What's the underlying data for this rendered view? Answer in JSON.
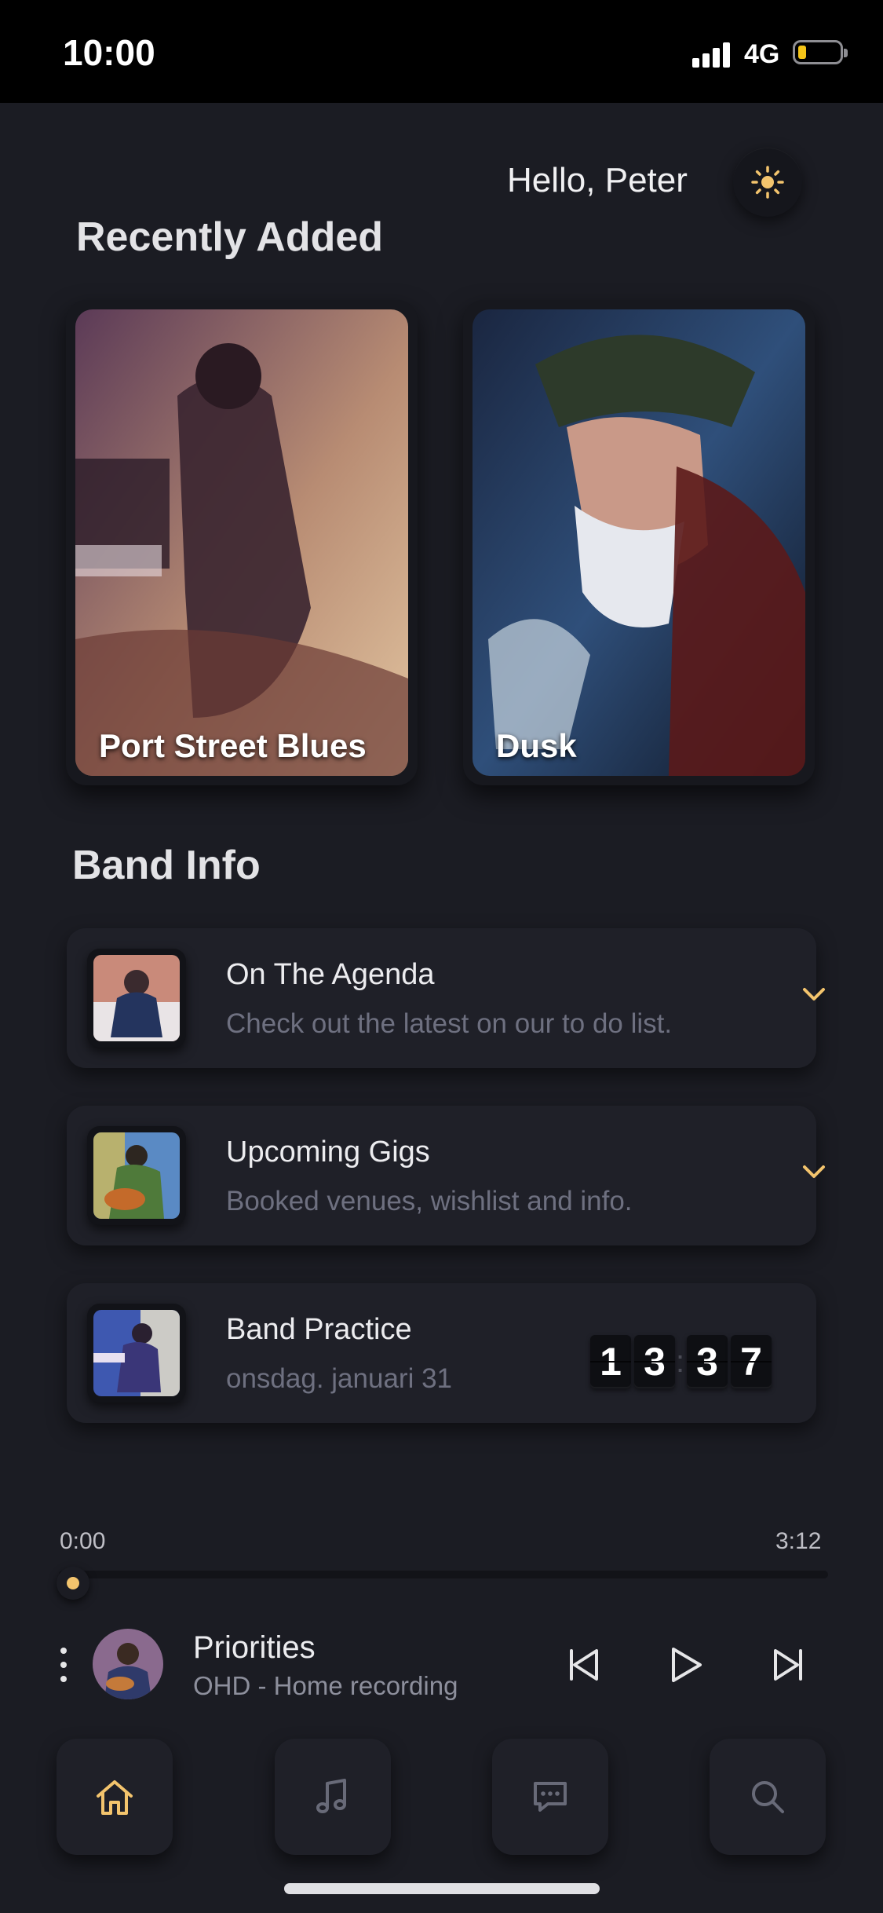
{
  "status_bar": {
    "time": "10:00",
    "network": "4G"
  },
  "header": {
    "greeting": "Hello, Peter",
    "theme_icon": "sun-icon"
  },
  "recently_added": {
    "title": "Recently Added",
    "albums": [
      {
        "title": "Port Street Blues"
      },
      {
        "title": "Dusk"
      }
    ]
  },
  "band_info": {
    "title": "Band Info",
    "cards": [
      {
        "title": "On The Agenda",
        "subtitle": "Check out the latest on our to do list.",
        "icon": "chevron-down-icon"
      },
      {
        "title": "Upcoming Gigs",
        "subtitle": "Booked venues, wishlist and info.",
        "icon": "chevron-down-icon"
      },
      {
        "title": "Band Practice",
        "subtitle": "onsdag. januari 31",
        "clock": [
          "1",
          "3",
          "3",
          "7"
        ]
      }
    ]
  },
  "player": {
    "elapsed": "0:00",
    "duration": "3:12",
    "progress": 0.0,
    "track_title": "Priorities",
    "track_subtitle": "OHD - Home recording"
  },
  "nav": [
    "home-icon",
    "music-note-icon",
    "chat-icon",
    "search-icon"
  ],
  "colors": {
    "accent": "#f3c46d",
    "background": "#1b1c23",
    "card": "#1f2028"
  }
}
